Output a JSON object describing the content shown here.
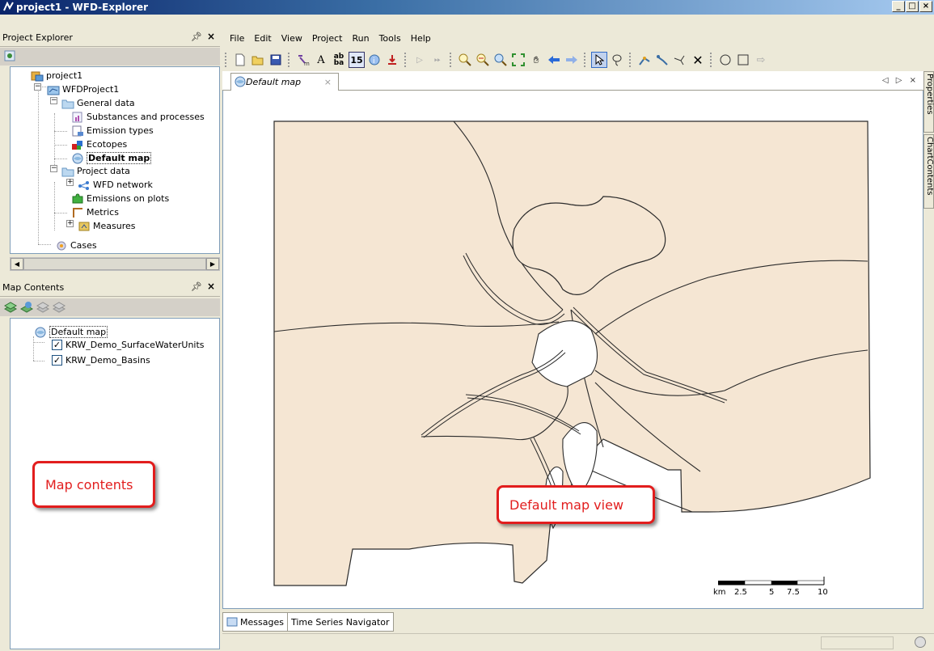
{
  "window": {
    "title": "project1 - WFD-Explorer",
    "buttons": [
      "_",
      "□",
      "×"
    ]
  },
  "project_explorer": {
    "title": "Project Explorer",
    "pin": "ᵖ",
    "close": "×",
    "tree": {
      "root": "project1",
      "project": "WFDProject1",
      "general_data": "General data",
      "substances": "Substances and processes",
      "emission_types": "Emission types",
      "ecotopes": "Ecotopes",
      "default_map": "Default map",
      "project_data": "Project data",
      "wfd_network": "WFD network",
      "emissions_on_plots": "Emissions on plots",
      "metrics": "Metrics",
      "measures": "Measures",
      "cases": "Cases"
    }
  },
  "map_contents": {
    "title": "Map Contents",
    "close": "×",
    "root": "Default map",
    "layers": [
      {
        "name": "KRW_Demo_SurfaceWaterUnits",
        "checked": true
      },
      {
        "name": "KRW_Demo_Basins",
        "checked": true
      }
    ]
  },
  "menu": [
    "File",
    "Edit",
    "View",
    "Project",
    "Run",
    "Tools",
    "Help"
  ],
  "toolbar": {
    "icons": [
      "new-icon",
      "open-icon",
      "save-icon",
      "network-icon",
      "text-icon",
      "label-icon",
      "calendar-icon",
      "info-icon",
      "import-icon",
      "play-icon",
      "fast-forward-icon",
      "zoom-in-icon",
      "zoom-out-icon",
      "zoom-extent-icon",
      "full-extent-icon",
      "pan-icon",
      "back-icon",
      "forward-icon",
      "select-icon",
      "lasso-icon",
      "add-node-icon",
      "move-node-icon",
      "add-branch-icon",
      "delete-icon",
      "circle-icon",
      "square-icon",
      "arrow-icon"
    ],
    "calendar_label": "15"
  },
  "document": {
    "tab_label": "Default map",
    "tab_close": "×",
    "nav": "◁ ▷ ×"
  },
  "side_tabs": [
    "Properties",
    "ChartContents"
  ],
  "map": {
    "scale_unit": "km",
    "scale_ticks": [
      "2.5",
      "5",
      "7.5",
      "10"
    ],
    "fill_color": "#f5e6d3",
    "line_color": "#2b2b2b"
  },
  "bottom_tabs": [
    "Messages",
    "Time Series Navigator"
  ],
  "callouts": {
    "map_contents": "Map contents",
    "map_view": "Default map view"
  },
  "colors": {
    "callout_red": "#e21d1d",
    "title_blue": "#0a246a"
  }
}
